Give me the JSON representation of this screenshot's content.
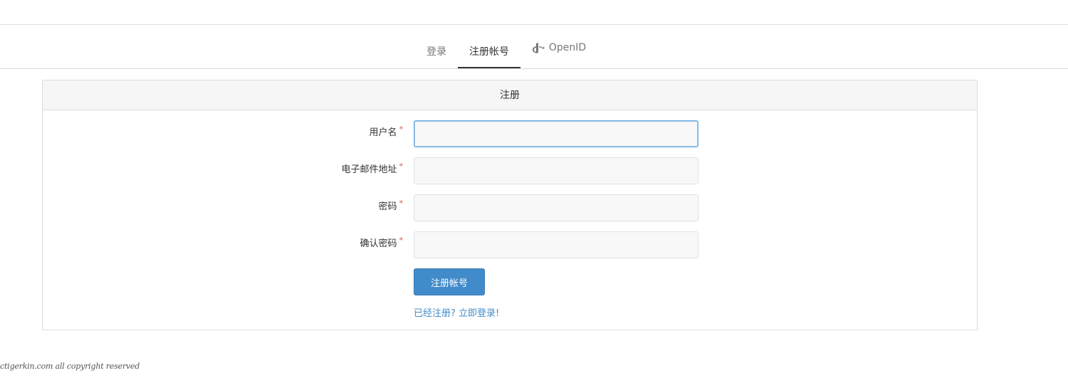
{
  "tabs": [
    {
      "label": "登录",
      "active": false
    },
    {
      "label": "注册帐号",
      "active": true
    },
    {
      "label": "OpenID",
      "active": false,
      "icon": "openid-icon"
    }
  ],
  "panel": {
    "title": "注册"
  },
  "form": {
    "fields": [
      {
        "label": "用户名",
        "required_mark": "*",
        "value": "",
        "focused": true
      },
      {
        "label": "电子邮件地址",
        "required_mark": "*",
        "value": "",
        "focused": false
      },
      {
        "label": "密码",
        "required_mark": "*",
        "value": "",
        "focused": false
      },
      {
        "label": "确认密码",
        "required_mark": "*",
        "value": "",
        "focused": false
      }
    ],
    "submit_label": "注册帐号",
    "login_link": "已经注册? 立即登录!"
  },
  "footer": {
    "text": "ctigerkin.com all copyright reserved"
  },
  "colors": {
    "primary": "#428bca",
    "required": "#d9534f",
    "panel_heading_bg": "#f6f6f6"
  }
}
